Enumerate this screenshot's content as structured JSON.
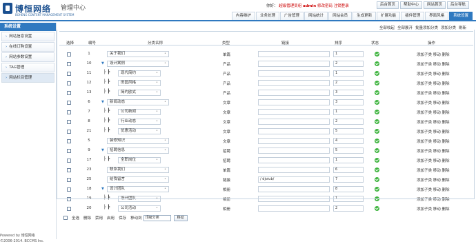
{
  "brand": {
    "name_cn": "博恒网络",
    "name_en": "BOHENG CONTENT MANAGEMENT SYSTEM",
    "title": "管理中心"
  },
  "top_info": {
    "greeting": "你好：",
    "role": "超级管理员组",
    "user": "admin",
    "actions": "修改密码 注销登录"
  },
  "top_buttons": [
    "后台首页",
    "帮助中心",
    "网站首页",
    "后台导航"
  ],
  "nav_tabs": [
    {
      "label": "内容维护",
      "active": false
    },
    {
      "label": "业务处理",
      "active": false
    },
    {
      "label": "广告管理",
      "active": false
    },
    {
      "label": "网站统计",
      "active": false
    },
    {
      "label": "网站会员",
      "active": false
    },
    {
      "label": "生成更新",
      "active": false
    },
    {
      "label": "扩展功能",
      "active": false
    },
    {
      "label": "插件管理",
      "active": false
    },
    {
      "label": "界面风格",
      "active": false
    },
    {
      "label": "系统设置",
      "active": true
    }
  ],
  "sidebar": {
    "title": "系统设置",
    "items": [
      {
        "label": "网站信息设置",
        "active": false
      },
      {
        "label": "在线订购设置",
        "active": false
      },
      {
        "label": "网站参数设置",
        "active": false
      },
      {
        "label": "TAG管理",
        "active": false
      },
      {
        "label": "网站栏目管理",
        "active": true
      }
    ]
  },
  "footer": {
    "line1": "Powered by 博恒网络",
    "line2": "©2006-2014. BCCMS Inc."
  },
  "toolbar": {
    "links": [
      "全部收起",
      "全部展开",
      "批量添加分类",
      "添加分类",
      "刷新"
    ]
  },
  "table": {
    "headers": {
      "select": "选择",
      "id": "编号",
      "name": "分类名称",
      "type": "类型",
      "link": "链接",
      "sort": "排序",
      "status": "状态",
      "ops": "操作"
    },
    "ops_text": "添加子类 移动 删除",
    "rows": [
      {
        "id": "1",
        "name": "关于我们",
        "level": 0,
        "toggle": "",
        "type": "单篇",
        "link": "",
        "sort": "1"
      },
      {
        "id": "10",
        "name": "设计案例",
        "level": 0,
        "toggle": "▼",
        "type": "产品",
        "link": "",
        "sort": "2"
      },
      {
        "id": "11",
        "name": "现代简约",
        "level": 1,
        "toggle": "",
        "type": "产品",
        "link": "",
        "sort": "1"
      },
      {
        "id": "12",
        "name": "田园风格",
        "level": 1,
        "toggle": "",
        "type": "产品",
        "link": "",
        "sort": "2"
      },
      {
        "id": "13",
        "name": "简约欧式",
        "level": 1,
        "toggle": "",
        "type": "产品",
        "link": "",
        "sort": "3"
      },
      {
        "id": "6",
        "name": "新闻动态",
        "level": 0,
        "toggle": "▼",
        "type": "文章",
        "link": "",
        "sort": "3"
      },
      {
        "id": "7",
        "name": "公司新闻",
        "level": 1,
        "toggle": "",
        "type": "文章",
        "link": "",
        "sort": "1"
      },
      {
        "id": "8",
        "name": "行业动态",
        "level": 1,
        "toggle": "",
        "type": "文章",
        "link": "",
        "sort": "2"
      },
      {
        "id": "21",
        "name": "优惠活动",
        "level": 1,
        "toggle": "",
        "type": "文章",
        "link": "",
        "sort": "5"
      },
      {
        "id": "5",
        "name": "装修知识",
        "level": 0,
        "toggle": "",
        "type": "文章",
        "link": "",
        "sort": "4"
      },
      {
        "id": "9",
        "name": "招聘信息",
        "level": 0,
        "toggle": "▼",
        "type": "招聘",
        "link": "",
        "sort": "5"
      },
      {
        "id": "17",
        "name": "全职岗位",
        "level": 1,
        "toggle": "",
        "type": "招聘",
        "link": "",
        "sort": "1"
      },
      {
        "id": "23",
        "name": "联系我们",
        "level": 0,
        "toggle": "",
        "type": "单篇",
        "link": "",
        "sort": "6"
      },
      {
        "id": "25",
        "name": "给我留言",
        "level": 0,
        "toggle": "",
        "type": "链接",
        "link": "/ djoiub/",
        "sort": "7"
      },
      {
        "id": "18",
        "name": "设计团队",
        "level": 0,
        "toggle": "▼",
        "type": "相册",
        "link": "",
        "sort": "8"
      },
      {
        "id": "19",
        "name": "设计团队",
        "level": 1,
        "toggle": "",
        "type": "相册",
        "link": "",
        "sort": "1"
      },
      {
        "id": "20",
        "name": "公司活动",
        "level": 1,
        "toggle": "",
        "type": "相册",
        "link": "",
        "sort": "2"
      }
    ]
  },
  "bottom_bar": {
    "select_all": "全选",
    "actions": [
      "删除",
      "禁用",
      "启用",
      "保存"
    ],
    "move_label": "移动到",
    "move_select": "顶级分类",
    "move_button": "移动"
  },
  "colors": {
    "accent": "#2f79c0",
    "status_ok": "#3db33d",
    "warning": "#cc0000"
  }
}
